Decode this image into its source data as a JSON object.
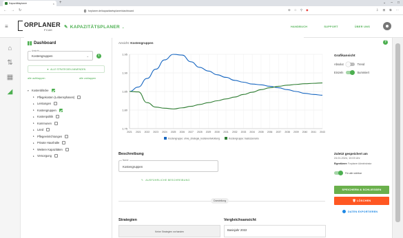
{
  "browser": {
    "tab_title": "Kapazitätsplaner",
    "tab_close": "×",
    "new_tab": "+",
    "window_controls": [
      "⌄",
      "–",
      "□"
    ],
    "nav_icons": [
      "←",
      "→",
      "↻"
    ],
    "url": "forplaner.de/kapazitaetsplaner/dashboard",
    "address_icons": [
      "⊕",
      "☆",
      "⚲",
      "◆"
    ],
    "right_icons": [
      "⇩",
      "⊞",
      "⧉",
      "⋯"
    ]
  },
  "header": {
    "logo_main": "ORPLANER",
    "logo_sub": "FC&K",
    "module": "KAPAZITÄTSPLANER",
    "module_chevron": "⌄",
    "menu_icon": "≡",
    "links": [
      "HANDBUCH",
      "SUPPORT",
      "ÜBER UNS"
    ]
  },
  "rail": {
    "icons": [
      "⌂",
      "⇅",
      "▦",
      "◢"
    ]
  },
  "sidebar": {
    "title": "Dashboard",
    "select_label": "Ansicht",
    "select_value": "Kostengruppen",
    "select_arrow": "⌄",
    "info": "i",
    "filter_label": "ALLE STRATEGIEN ANWENDEN",
    "filter_icon": "▼",
    "expand_all": "alle aufklappen",
    "collapse_all": "alle zuklappen",
    "tree": [
      {
        "label": "Kostenblöcke",
        "checked": true,
        "child": false,
        "caret": "▾"
      },
      {
        "label": "Pflegekosten (Lebensphasen)",
        "checked": false,
        "child": true,
        "caret": "▸"
      },
      {
        "label": "Leistungen",
        "checked": false,
        "child": true,
        "caret": "▸"
      },
      {
        "label": "Kostengruppen",
        "checked": true,
        "child": true,
        "caret": "▸"
      },
      {
        "label": "Kostenpolitik",
        "checked": false,
        "child": true,
        "caret": "▸"
      },
      {
        "label": "Kommunen",
        "checked": false,
        "child": true,
        "caret": "▸"
      },
      {
        "label": "Land",
        "checked": false,
        "child": true,
        "caret": "▸"
      },
      {
        "label": "Pflegeeinrichtungen",
        "checked": false,
        "child": true,
        "caret": "▸"
      },
      {
        "label": "Private Haushalte",
        "checked": false,
        "child": true,
        "caret": "▸"
      },
      {
        "label": "Weitere Kapazitäten",
        "checked": false,
        "child": true,
        "caret": "▸"
      },
      {
        "label": "Versorgung",
        "checked": false,
        "child": true,
        "caret": "▸"
      }
    ]
  },
  "main": {
    "view_label": "Ansicht:",
    "view_value": "Kostengruppen",
    "help": "?"
  },
  "chart_data": {
    "type": "line",
    "x": [
      2021,
      2022,
      2023,
      2024,
      2025,
      2026,
      2027,
      2028,
      2029,
      2030,
      2031,
      2032,
      2033,
      2034,
      2035,
      2036,
      2037,
      2038,
      2039,
      2040,
      2041,
      2042,
      2043
    ],
    "x_tick_labels": [
      "2021",
      "2021",
      "2022",
      "2023",
      "2024",
      "2025",
      "2026",
      "2027",
      "2028",
      "2029",
      "2030",
      "2031",
      "2032",
      "2033",
      "2034",
      "2035",
      "2036",
      "2037",
      "2038",
      "2039",
      "2040",
      "2041",
      "2043"
    ],
    "y_tick_labels": [
      "1.75",
      "1.80",
      "1.85",
      "1.90",
      "1.95"
    ],
    "ylim": [
      1.75,
      1.95
    ],
    "grid": true,
    "legend_position": "bottom",
    "series": [
      {
        "name": "Kostengruppe: ohne_strategie_kostenentwicklung",
        "color": "#1565c0",
        "values": [
          1.85,
          1.862,
          1.885,
          1.91,
          1.935,
          1.95,
          1.948,
          1.93,
          1.915,
          1.905,
          1.895,
          1.888,
          1.88,
          1.875,
          1.87,
          1.868,
          1.864,
          1.86,
          1.855,
          1.85,
          1.845,
          1.842,
          1.84
        ]
      },
      {
        "name": "Kostengruppe: basisszenario",
        "color": "#2e7d32",
        "values": [
          1.85,
          1.849,
          1.82,
          1.808,
          1.805,
          1.803,
          1.806,
          1.81,
          1.815,
          1.82,
          1.825,
          1.83,
          1.835,
          1.842,
          1.848,
          1.855,
          1.86,
          1.864,
          1.867,
          1.869,
          1.871,
          1.872,
          1.873
        ]
      }
    ]
  },
  "graph_view": {
    "title": "Grafikansicht",
    "toggle1_label_left": "Absolut",
    "toggle1_label_right": "Trend",
    "toggle2_label_left": "Einzeln",
    "toggle2_label_right": "Summiert"
  },
  "description": {
    "title": "Beschreibung",
    "field_label": "Name",
    "field_value": "Kostengruppen",
    "detail_button": "AUSFÜHRLICHE BESCHREIBUNG",
    "divider_chip": "Darstellung"
  },
  "strategies": {
    "title": "Strategien",
    "empty": "Keine Strategien vorhanden"
  },
  "comparison": {
    "title": "Vergleichsansicht",
    "value": "Basisjahr 2022"
  },
  "save": {
    "title": "Zuletzt gespeichert am",
    "date": "24.01.2024, 10:03 Uhr",
    "owner_label": "Eigentümer:",
    "owner": "Forplaner Administrator",
    "public_label": "Für alle sichtbar",
    "save_button": "SPEICHERN & SCHLIESSEN",
    "delete_button": "LÖSCHEN",
    "delete_icon": "🗑",
    "export_button": "DATEN EXPORTIEREN"
  }
}
